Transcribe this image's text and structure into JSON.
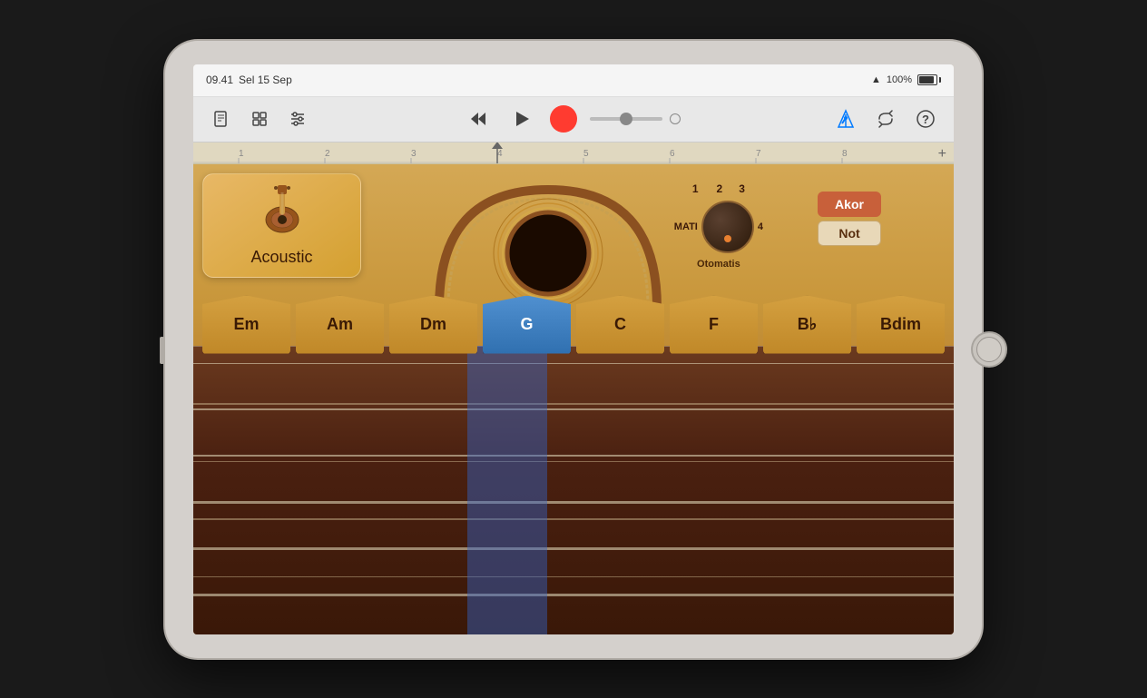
{
  "device": {
    "time": "09.41",
    "date": "Sel 15 Sep",
    "wifi_strength": "3/3",
    "battery_percent": "100%"
  },
  "toolbar": {
    "new_song_label": "📄",
    "tracks_label": "⊞",
    "settings_label": "⚙",
    "rewind_label": "⏮",
    "play_label": "▶",
    "record_label": "●",
    "metronome_label": "🎵",
    "loop_label": "↩",
    "help_label": "?"
  },
  "ruler": {
    "numbers": [
      "1",
      "2",
      "3",
      "4",
      "5",
      "6",
      "7",
      "8"
    ],
    "add_label": "+"
  },
  "instrument": {
    "name": "Acoustic",
    "knob": {
      "positions": [
        "MATI",
        "1",
        "2",
        "3",
        "4"
      ],
      "label": "Otomatis"
    },
    "chord_tab": "Akor",
    "note_tab": "Not",
    "chords": [
      "Em",
      "Am",
      "Dm",
      "G",
      "C",
      "F",
      "B♭",
      "Bdim"
    ],
    "active_chord": "G",
    "strings": 6,
    "frets": 5
  }
}
